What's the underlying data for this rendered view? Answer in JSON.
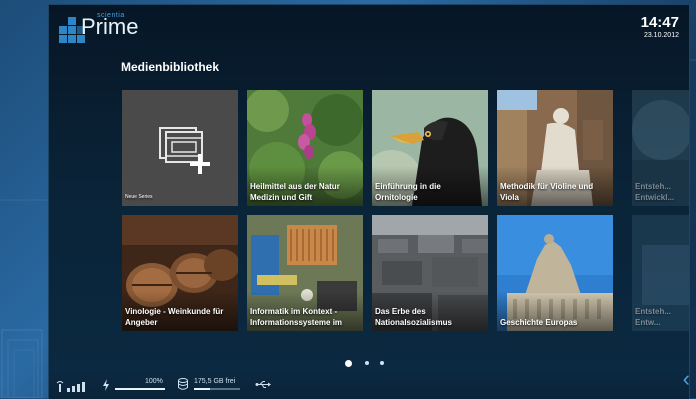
{
  "header": {
    "logo_sub": "scientia",
    "logo_word": "Prime",
    "time": "14:47",
    "date": "23.10.2012"
  },
  "section_title": "Medienbibliothek",
  "tiles": [
    {
      "label": "Neue Series"
    },
    {
      "label": "Heilmittel aus der Natur Medizin und Gift"
    },
    {
      "label": "Einführung in die Ornitologie"
    },
    {
      "label": "Methodik für Violine und Viola"
    },
    {
      "label": "Entsteh... Entwickl..."
    },
    {
      "label": "Vinologie - Weinkunde für Angeber"
    },
    {
      "label": "Informatik im Kontext - Informationssysteme im"
    },
    {
      "label": "Das Erbe des Nationalsozialismus"
    },
    {
      "label": "Geschichte Europas"
    },
    {
      "label": "Entsteh... Entw..."
    }
  ],
  "pagination": {
    "pages": 3,
    "current": 1
  },
  "status": {
    "battery_percent": "100%",
    "battery_level": 1.0,
    "storage_free": "175,5 GB frei",
    "storage_used_fraction": 0.35
  },
  "icons": {
    "signal": "signal-icon",
    "power": "power-icon",
    "storage": "storage-icon",
    "usb": "usb-icon",
    "back": "chevron-left-icon",
    "new_series": "add-film-icon"
  }
}
